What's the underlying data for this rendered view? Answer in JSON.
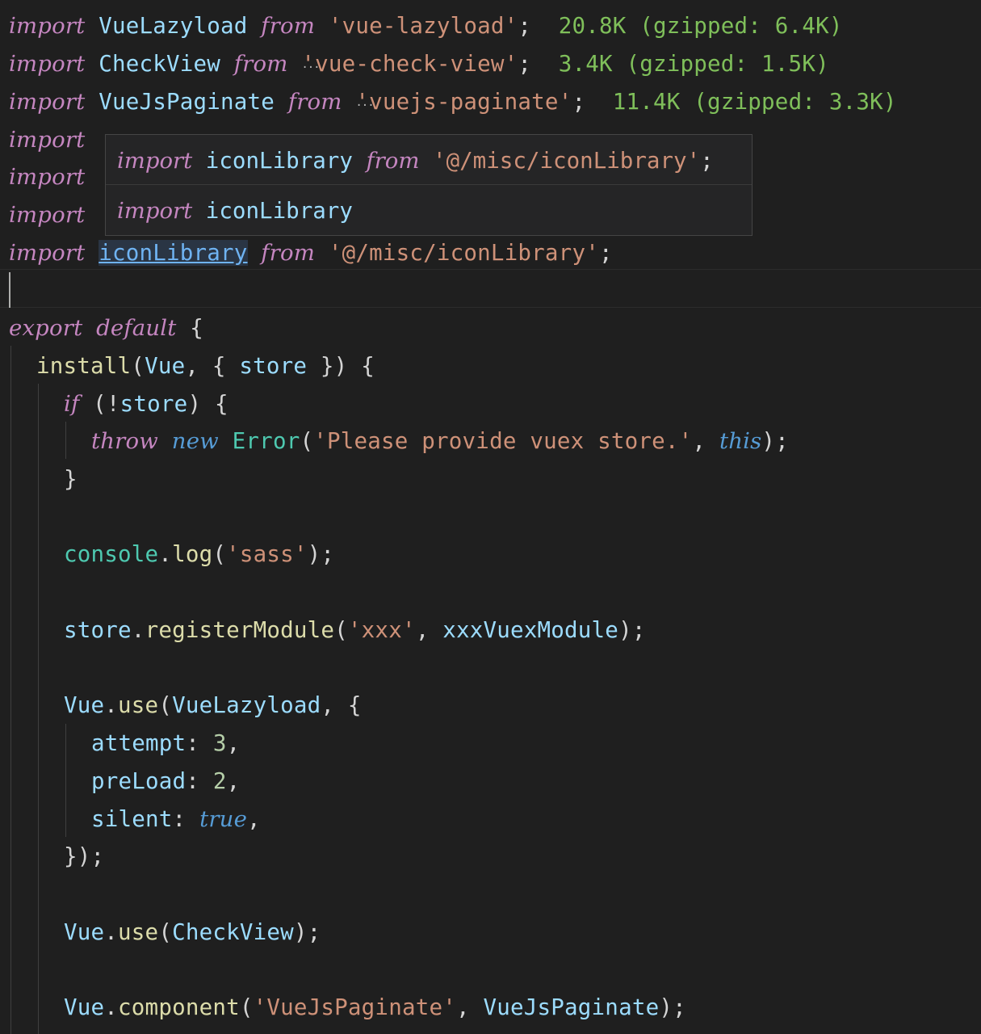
{
  "lines": {
    "l1": {
      "kw": "import",
      "name": "VueLazyload",
      "from": "from",
      "src": "'vue-lazyload'",
      "semi": ";",
      "cost": "20.8K (gzipped: 6.4K)"
    },
    "l2": {
      "kw": "import",
      "name": "CheckView",
      "from": "from",
      "src": "'vue-check-view'",
      "semi": ";",
      "cost": "3.4K (gzipped: 1.5K)"
    },
    "l3": {
      "kw": "import",
      "name": "VueJsPaginate",
      "from": "from",
      "src": "'vuejs-paginate'",
      "semi": ";",
      "cost": "11.4K (gzipped: 3.3K)"
    },
    "l4": {
      "kw": "import"
    },
    "l5": {
      "kw": "import"
    },
    "l6": {
      "kw": "import"
    },
    "l7": {
      "kw": "import",
      "name": "iconLibrary",
      "from": "from",
      "src": "'@/misc/iconLibrary'",
      "semi": ";"
    },
    "export": {
      "kw1": "export",
      "kw2": "default",
      "brace": "{"
    },
    "install": {
      "fn": "install",
      "open": "(",
      "arg": "Vue",
      "rest": ", { ",
      "store": "store",
      "close": " }) {"
    },
    "if": {
      "kw": "if",
      "cond_open": " (!",
      "store": "store",
      "cond_close": ") {"
    },
    "throw": {
      "kw1": "throw",
      "kw2": "new",
      "cls": "Error",
      "open": "(",
      "str": "'Please provide vuex store.'",
      "comma": ", ",
      "this": "this",
      "close": ");"
    },
    "close_if": "}",
    "console": {
      "obj": "console",
      "dot": ".",
      "fn": "log",
      "open": "(",
      "str": "'sass'",
      "close": ");"
    },
    "register": {
      "obj": "store",
      "dot": ".",
      "fn": "registerModule",
      "open": "(",
      "str": "'xxx'",
      "comma": ", ",
      "arg": "xxxVuexModule",
      "close": ");"
    },
    "use1": {
      "obj": "Vue",
      "dot": ".",
      "fn": "use",
      "open": "(",
      "arg": "VueLazyload",
      "rest": ", {"
    },
    "attempt": {
      "key": "attempt",
      "colon": ": ",
      "val": "3",
      "comma": ","
    },
    "preload": {
      "key": "preLoad",
      "colon": ": ",
      "val": "2",
      "comma": ","
    },
    "silent": {
      "key": "silent",
      "colon": ": ",
      "val": "true",
      "comma": ","
    },
    "close_use1": "});",
    "use2": {
      "obj": "Vue",
      "dot": ".",
      "fn": "use",
      "open": "(",
      "arg": "CheckView",
      "close": ");"
    },
    "component": {
      "obj": "Vue",
      "dot": ".",
      "fn": "component",
      "open": "(",
      "str": "'VueJsPaginate'",
      "comma": ", ",
      "arg": "VueJsPaginate",
      "close": ");"
    }
  },
  "popup": {
    "row1": {
      "kw": "import",
      "name": "iconLibrary",
      "from": "from",
      "src": "'@/misc/iconLibrary'",
      "semi": ";"
    },
    "row2": {
      "kw": "import",
      "name": "iconLibrary"
    }
  },
  "colors": {
    "background": "#1f1f1f",
    "keyword": "#c586c0",
    "variable": "#9cdcfe",
    "function": "#dcdcaa",
    "class": "#4ec9b0",
    "string": "#ce9178",
    "number": "#b5cea8",
    "import_cost": "#7fbf5a"
  }
}
